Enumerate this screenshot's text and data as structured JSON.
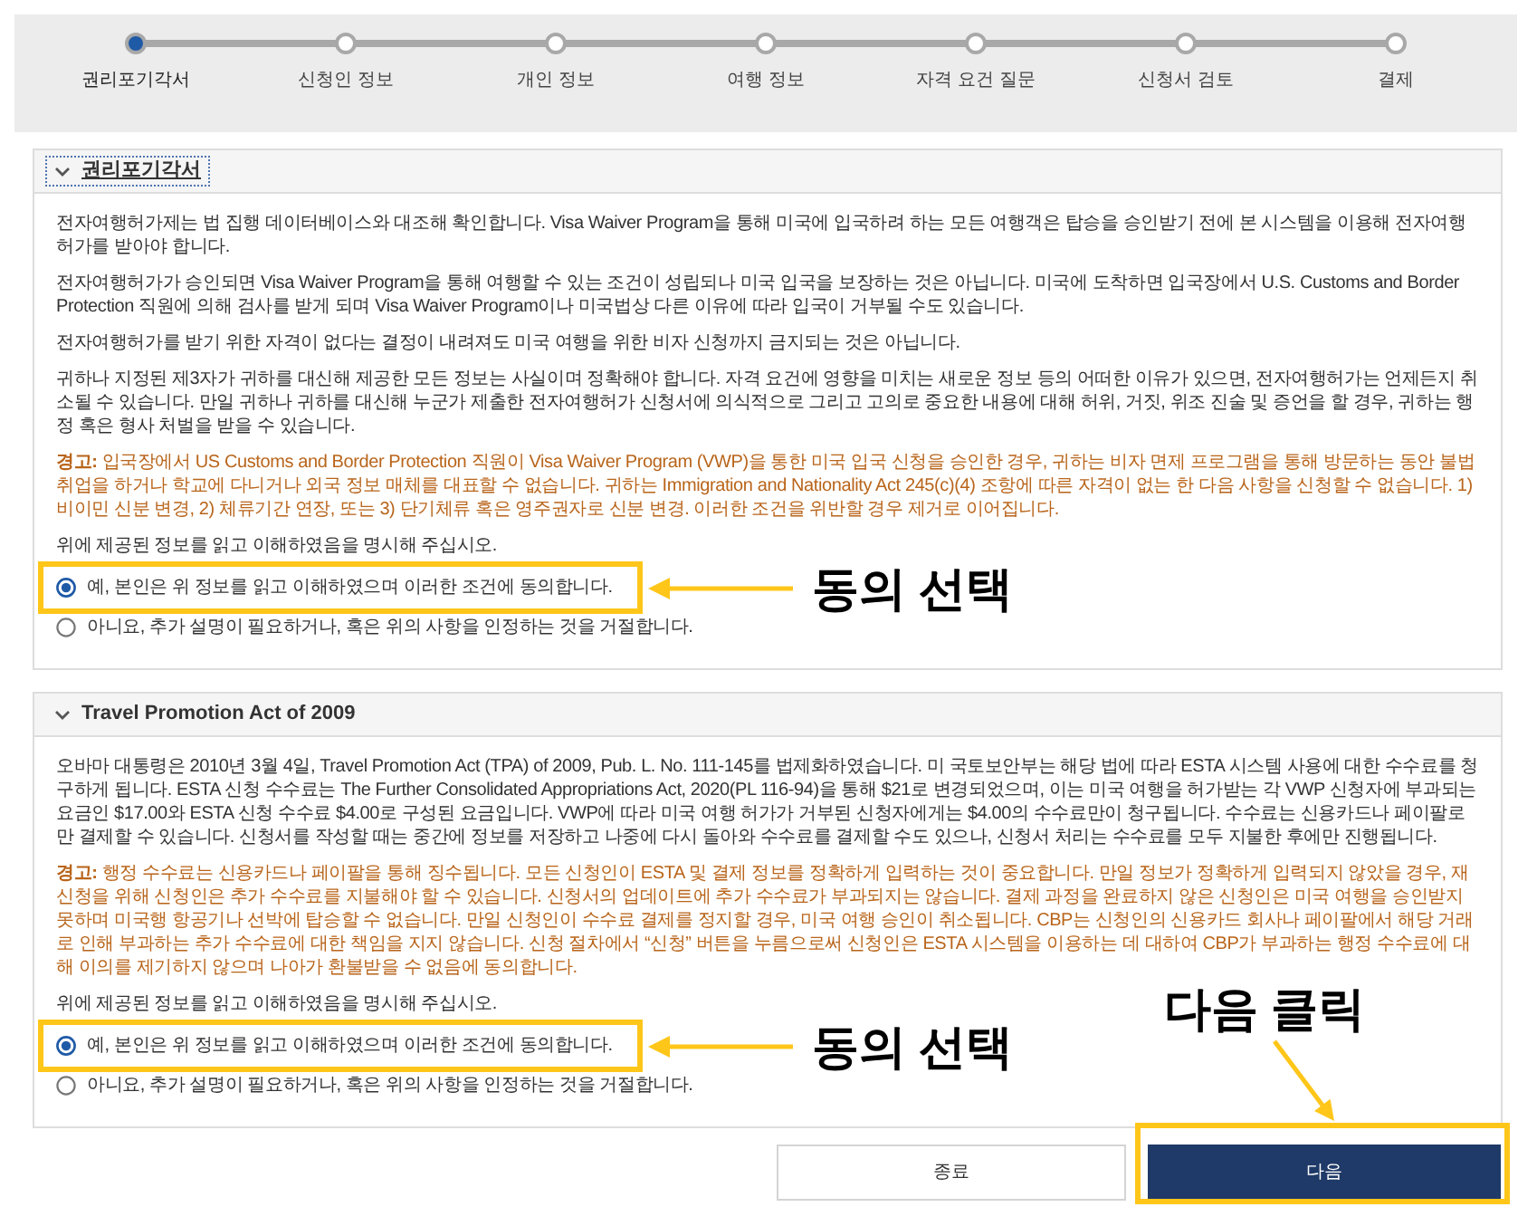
{
  "stepper": {
    "steps": [
      {
        "label": "권리포기각서",
        "selected": true
      },
      {
        "label": "신청인 정보",
        "selected": false
      },
      {
        "label": "개인 정보",
        "selected": false
      },
      {
        "label": "여행 정보",
        "selected": false
      },
      {
        "label": "자격 요건 질문",
        "selected": false
      },
      {
        "label": "신청서 검토",
        "selected": false
      },
      {
        "label": "결제",
        "selected": false
      }
    ]
  },
  "sections": [
    {
      "title": "권리포기각서",
      "expanded": true,
      "focused": true,
      "paragraphs": [
        {
          "kind": "text",
          "text": "전자여행허가제는 법 집행 데이터베이스와 대조해 확인합니다. Visa Waiver Program을 통해 미국에 입국하려 하는 모든 여행객은 탑승을 승인받기 전에 본 시스템을 이용해 전자여행허가를 받아야 합니다."
        },
        {
          "kind": "text",
          "text": "전자여행허가가 승인되면 Visa Waiver Program을 통해 여행할 수 있는 조건이 성립되나 미국 입국을 보장하는 것은 아닙니다. 미국에 도착하면 입국장에서 U.S. Customs and Border Protection 직원에 의해 검사를 받게 되며 Visa Waiver Program이나 미국법상 다른 이유에 따라 입국이 거부될 수도 있습니다."
        },
        {
          "kind": "text",
          "text": "전자여행허가를 받기 위한 자격이 없다는 결정이 내려져도 미국 여행을 위한 비자 신청까지 금지되는 것은 아닙니다."
        },
        {
          "kind": "text",
          "text": "귀하나 지정된 제3자가 귀하를 대신해 제공한 모든 정보는 사실이며 정확해야 합니다. 자격 요건에 영향을 미치는 새로운 정보 등의 어떠한 이유가 있으면, 전자여행허가는 언제든지 취소될 수 있습니다. 만일 귀하나 귀하를 대신해 누군가 제출한 전자여행허가 신청서에 의식적으로 그리고 고의로 중요한 내용에 대해 허위, 거짓, 위조 진술 및 증언을 할 경우, 귀하는 행정 혹은 형사 처벌을 받을 수 있습니다."
        },
        {
          "kind": "warning",
          "text": "**경고:** 입국장에서 US Customs and Border Protection 직원이 Visa Waiver Program (VWP)을 통한 미국 입국 신청을 승인한 경우, 귀하는 비자 면제 프로그램을 통해 방문하는 동안 불법 취업을 하거나 학교에 다니거나 외국 정보 매체를 대표할 수 없습니다. 귀하는 Immigration and Nationality Act 245(c)(4) 조항에 따른 자격이 없는 한 다음 사항을 신청할 수 없습니다. 1) 비이민 신분 변경, 2) 체류기간 연장, 또는 3) 단기체류 혹은 영주권자로 신분 변경. 이러한 조건을 위반할 경우 제거로 이어집니다."
        }
      ],
      "prompt": "위에 제공된 정보를 읽고 이해하였음을 명시해 주십시오.",
      "options": [
        {
          "label": "예, 본인은 위 정보를 읽고 이해하였으며 이러한 조건에 동의합니다.",
          "selected": true,
          "highlighted": true,
          "callout": "동의 선택"
        },
        {
          "label": "아니요, 추가 설명이 필요하거나, 혹은 위의 사항을 인정하는 것을 거절합니다.",
          "selected": false,
          "highlighted": false
        }
      ]
    },
    {
      "title": "Travel Promotion Act of 2009",
      "expanded": true,
      "focused": false,
      "paragraphs": [
        {
          "kind": "text",
          "text": "오바마 대통령은 2010년 3월 4일, Travel Promotion Act (TPA) of 2009, Pub. L. No. 111-145를 법제화하였습니다. 미 국토보안부는 해당 법에 따라 ESTA 시스템 사용에 대한 수수료를 청구하게 됩니다. ESTA 신청 수수료는 The Further Consolidated Appropriations Act, 2020(PL 116-94)을 통해 $21로 변경되었으며, 이는 미국 여행을 허가받는 각 VWP 신청자에 부과되는 요금인 $17.00와 ESTA 신청 수수료 $4.00로 구성된 요금입니다. VWP에 따라 미국 여행 허가가 거부된 신청자에게는 $4.00의 수수료만이 청구됩니다. 수수료는 신용카드나 페이팔로만 결제할 수 있습니다. 신청서를 작성할 때는 중간에 정보를 저장하고 나중에 다시 돌아와 수수료를 결제할 수도 있으나, 신청서 처리는 수수료를 모두 지불한 후에만 진행됩니다."
        },
        {
          "kind": "warning",
          "text": "**경고:** 행정 수수료는 신용카드나 페이팔을 통해 징수됩니다. 모든 신청인이 ESTA 및 결제 정보를 정확하게 입력하는 것이 중요합니다. 만일 정보가 정확하게 입력되지 않았을 경우, 재신청을 위해 신청인은 추가 수수료를 지불해야 할 수 있습니다. 신청서의 업데이트에 추가 수수료가 부과되지는 않습니다. 결제 과정을 완료하지 않은 신청인은 미국 여행을 승인받지 못하며 미국행 항공기나 선박에 탑승할 수 없습니다. 만일 신청인이 수수료 결제를 정지할 경우, 미국 여행 승인이 취소됩니다. CBP는 신청인의 신용카드 회사나 페이팔에서 해당 거래로 인해 부과하는 추가 수수료에 대한 책임을 지지 않습니다. 신청 절차에서 “신청” 버튼을 누름으로써 신청인은 ESTA 시스템을 이용하는 데 대하여 CBP가 부과하는 행정 수수료에 대해 이의를 제기하지 않으며 나아가 환불받을 수 없음에 동의합니다."
        }
      ],
      "prompt": "위에 제공된 정보를 읽고 이해하였음을 명시해 주십시오.",
      "options": [
        {
          "label": "예, 본인은 위 정보를 읽고 이해하였으며 이러한 조건에 동의합니다.",
          "selected": true,
          "highlighted": true,
          "callout": "동의 선택"
        },
        {
          "label": "아니요, 추가 설명이 필요하거나, 혹은 위의 사항을 인정하는 것을 거절합니다.",
          "selected": false,
          "highlighted": false
        }
      ]
    }
  ],
  "buttons": [
    {
      "label": "종료",
      "kind": "secondary",
      "highlighted": false
    },
    {
      "label": "다음",
      "kind": "primary",
      "highlighted": true,
      "callout": "다음 클릭"
    }
  ]
}
